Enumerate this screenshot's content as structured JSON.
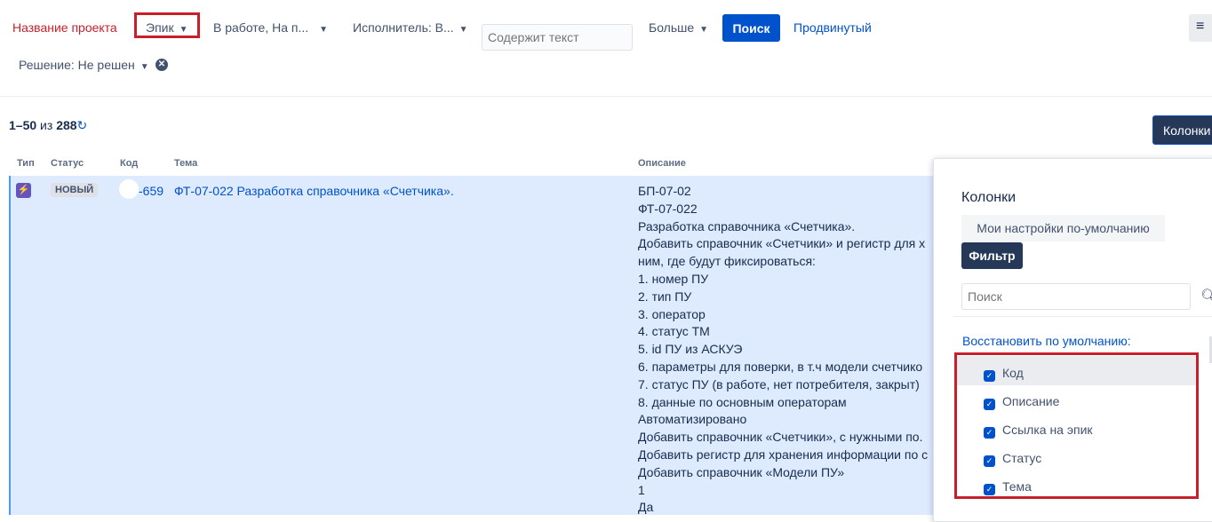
{
  "filters": {
    "project": "Название проекта",
    "epic": "Эпик",
    "status": "В работе, На п...",
    "assignee": "Исполнитель: В...",
    "text_placeholder": "Содержит текст",
    "more": "Больше",
    "search": "Поиск",
    "advanced": "Продвинутый",
    "resolution": "Решение: Не решен"
  },
  "results": {
    "range": "1–50",
    "of": "из",
    "total": "288"
  },
  "columns_button": "Колонки",
  "table": {
    "headers": [
      "Тип",
      "Статус",
      "Код",
      "Тема",
      "Описание"
    ],
    "row": {
      "status": "НОВЫЙ",
      "key": "-659",
      "summary": "ФТ-07-022 Разработка справочника «Счетчика».",
      "description": [
        "БП-07-02",
        "ФТ-07-022",
        "Разработка справочника «Счетчика».",
        "Добавить справочник «Счетчики» и регистр для х",
        "ним, где будут фиксироваться:",
        "1. номер ПУ",
        "2. тип ПУ",
        "3. оператор",
        "4. статус ТМ",
        "5. id ПУ из АСКУЭ",
        "6. параметры для поверки, в т.ч модели счетчико",
        "7. статус ПУ (в работе, нет потребителя, закрыт)",
        "8. данные по основным операторам",
        "Автоматизировано",
        "Добавить справочник «Счетчики», с нужными по.",
        "Добавить регистр для хранения информации по с",
        "Добавить справочник «Модели ПУ»",
        "1",
        "Да"
      ]
    }
  },
  "popup": {
    "title": "Колонки",
    "my_defaults": "Мои настройки по-умолчанию",
    "filter": "Фильтр",
    "search_placeholder": "Поиск",
    "restore": "Восстановить по умолчанию:",
    "items": [
      {
        "label": "Код",
        "checked": true
      },
      {
        "label": "Описание",
        "checked": true
      },
      {
        "label": "Ссылка на эпик",
        "checked": true
      },
      {
        "label": "Статус",
        "checked": true
      },
      {
        "label": "Тема",
        "checked": true
      }
    ]
  },
  "colors": {
    "accent": "#0052cc",
    "highlight": "#c8202a",
    "dark_button": "#253858",
    "row_selected": "#deebff"
  }
}
